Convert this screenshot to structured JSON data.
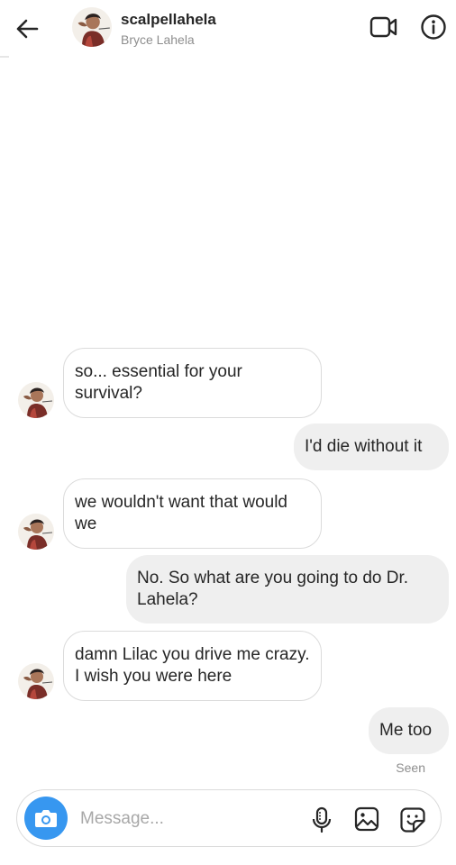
{
  "header": {
    "username": "scalpellahela",
    "full_name": "Bryce Lahela",
    "icons": {
      "back": "arrow-left-icon",
      "video": "video-camera-icon",
      "info": "info-icon"
    }
  },
  "messages": [
    {
      "sender": "them",
      "text": "so... essential for your survival?"
    },
    {
      "sender": "me",
      "text": "I'd die without it"
    },
    {
      "sender": "them",
      "text": "we wouldn't want that would we"
    },
    {
      "sender": "me",
      "text": "No. So what are you going to do Dr. Lahela?"
    },
    {
      "sender": "them",
      "text": "damn Lilac you drive me crazy. I wish you were here"
    },
    {
      "sender": "me",
      "text": "Me too"
    }
  ],
  "status": {
    "seen": "Seen"
  },
  "composer": {
    "placeholder": "Message...",
    "icons": {
      "camera": "camera-icon",
      "mic": "microphone-icon",
      "gallery": "gallery-icon",
      "sticker": "sticker-icon"
    }
  },
  "colors": {
    "accent": "#3797f0",
    "outgoing_bubble": "#efefef",
    "incoming_border": "#dbdbdb"
  }
}
